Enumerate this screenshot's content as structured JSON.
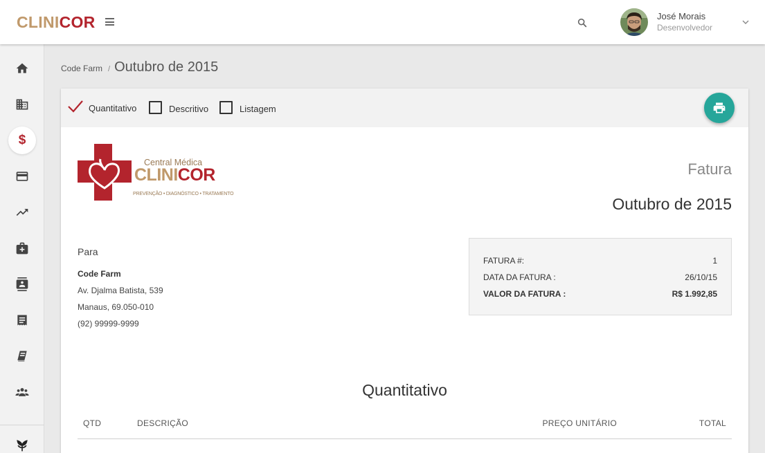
{
  "header": {
    "brand_part1": "CLINI",
    "brand_part2": "COR",
    "user_name": "José Morais",
    "user_role": "Desenvolvedor"
  },
  "sidebar": {
    "items": [
      {
        "icon": "home-icon"
      },
      {
        "icon": "building-icon"
      },
      {
        "icon": "dollar-icon",
        "label": "$",
        "active": true
      },
      {
        "icon": "credit-card-icon"
      },
      {
        "icon": "trending-up-icon"
      },
      {
        "icon": "medical-kit-icon"
      },
      {
        "icon": "contacts-icon"
      },
      {
        "icon": "receipt-icon"
      },
      {
        "icon": "book-icon"
      },
      {
        "icon": "group-icon"
      },
      {
        "icon": "leaf-icon"
      }
    ]
  },
  "breadcrumb": {
    "parent": "Code Farm",
    "separator": "/",
    "current": "Outubro de 2015"
  },
  "toolbar": {
    "options": [
      {
        "label": "Quantitativo",
        "checked": true
      },
      {
        "label": "Descritivo",
        "checked": false
      },
      {
        "label": "Listagem",
        "checked": false
      }
    ],
    "print_icon": "print-icon"
  },
  "logo": {
    "line1": "Central Médica",
    "line2a": "CLINI",
    "line2b": "COR",
    "tagline": "PREVENÇÃO • DIAGNÓSTICO • TRATAMENTO"
  },
  "invoice": {
    "label": "Fatura",
    "period": "Outubro de 2015",
    "to_label": "Para",
    "client": {
      "name": "Code Farm",
      "address": "Av. Djalma Batista, 539",
      "city": "Manaus, 69.050-010",
      "phone": "(92) 99999-9999"
    },
    "summary": {
      "number_label": "FATURA #:",
      "number_value": "1",
      "date_label": "DATA DA FATURA :",
      "date_value": "26/10/15",
      "total_label": "VALOR DA FATURA :",
      "total_value": "R$ 1.992,85"
    }
  },
  "section": {
    "title": "Quantitativo",
    "headers": {
      "qty": "QTD",
      "description": "DESCRIÇÃO",
      "unit_price": "PREÇO UNITÁRIO",
      "total": "TOTAL"
    }
  },
  "colors": {
    "brand_gold": "#c0996b",
    "brand_red": "#b3242d",
    "accent_teal": "#26a69a"
  }
}
